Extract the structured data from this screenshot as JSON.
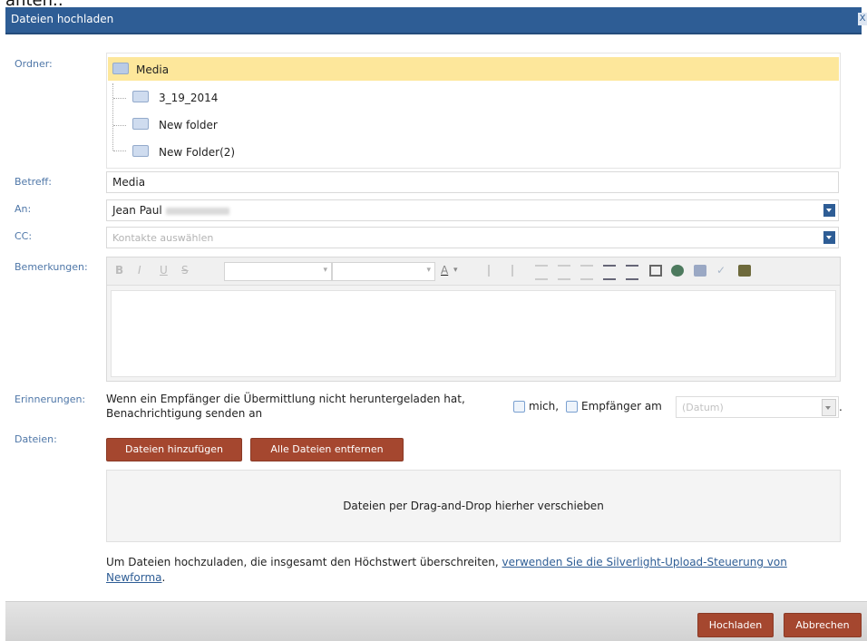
{
  "top_clip_text": "anten.:",
  "dialog": {
    "title": "Dateien hochladen",
    "close_label": "X"
  },
  "labels": {
    "folder": "Ordner:",
    "subject": "Betreff:",
    "to": "An:",
    "cc": "CC:",
    "remarks": "Bemerkungen:",
    "reminders": "Erinnerungen:",
    "files": "Dateien:"
  },
  "tree": {
    "root": "Media",
    "children": [
      "3_19_2014",
      "New folder",
      "New Folder(2)"
    ]
  },
  "subject_value": "Media",
  "to_value": "Jean Paul",
  "cc_placeholder": "Kontakte auswählen",
  "toolbar": {
    "bold": "B",
    "italic": "I",
    "underline": "U",
    "strike": "S",
    "font_color": "A"
  },
  "reminder": {
    "text": "Wenn ein Empfänger die Übermittlung nicht heruntergeladen hat, Benachrichtigung senden an",
    "me_label": "mich,",
    "recipient_label": "Empfänger am",
    "date_placeholder": "(Datum)",
    "trailing": "."
  },
  "buttons": {
    "add_files": "Dateien hinzufügen",
    "remove_all": "Alle Dateien entfernen",
    "upload": "Hochladen",
    "cancel": "Abbrechen"
  },
  "dropzone_text": "Dateien per Drag-and-Drop hierher verschieben",
  "info": {
    "text": "Um Dateien hochzuladen, die insgesamt den Höchstwert überschreiten, ",
    "link": "verwenden Sie die Silverlight-Upload-Steuerung von Newforma",
    "end": "."
  },
  "colors": {
    "title_bar": "#2e5d95",
    "label": "#4f77a8",
    "selected_row": "#fde79b",
    "button": "#a5472f"
  },
  "icons": [
    "folder-open-icon",
    "folder-icon",
    "dropdown-arrow-icon",
    "checkbox-icon"
  ]
}
